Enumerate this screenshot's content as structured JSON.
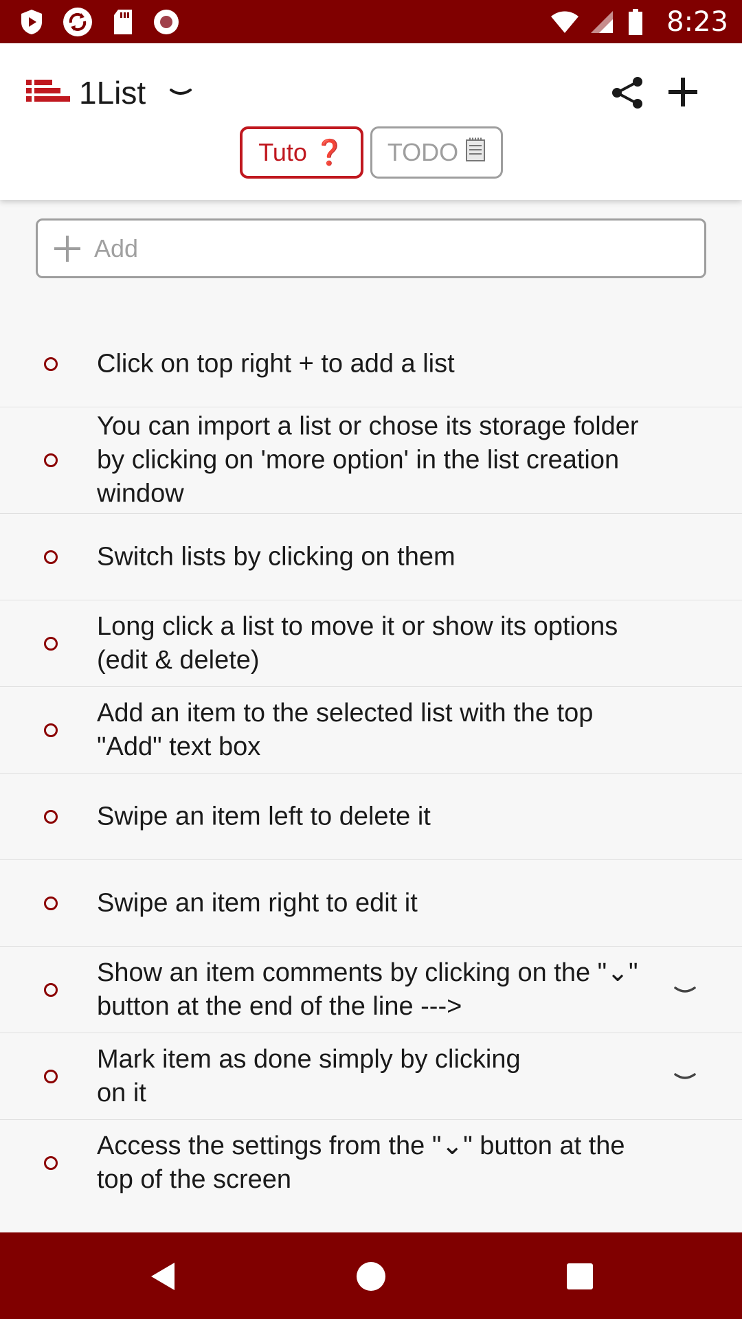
{
  "status_bar": {
    "time": "8:23",
    "icons": [
      "play-protect-icon",
      "sync-icon",
      "sd-card-icon",
      "record-icon",
      "wifi-icon",
      "signal-icon",
      "battery-icon"
    ]
  },
  "header": {
    "title": "1List",
    "tabs": [
      {
        "label": "Tuto",
        "emoji": "❓",
        "active": true
      },
      {
        "label": "TODO",
        "emoji": "🗒",
        "active": false
      }
    ]
  },
  "add_box": {
    "placeholder": "Add"
  },
  "items": [
    {
      "text": "Click on top right + to add a list",
      "has_comments": false
    },
    {
      "text": "You can import a list or chose its storage folder by clicking on 'more option' in the list creation window",
      "has_comments": false
    },
    {
      "text": "Switch lists by clicking on them",
      "has_comments": false
    },
    {
      "text": "Long click a list to move it or show its options (edit & delete)",
      "has_comments": false
    },
    {
      "text": "Add an item to the selected list with the top \"Add\" text box",
      "has_comments": false
    },
    {
      "text": "Swipe an item left to delete it",
      "has_comments": false
    },
    {
      "text": "Swipe an item right to edit it",
      "has_comments": false
    },
    {
      "text": "Show an item comments by clicking on the \"⌄\" button at the end of the line --->",
      "has_comments": true
    },
    {
      "text": "Mark item as done simply by clicking on it",
      "has_comments": true
    },
    {
      "text": "Access the settings from the \"⌄\" button at the top of the screen",
      "has_comments": false
    }
  ],
  "colors": {
    "primary": "#800000",
    "accent": "#c0181f",
    "bullet": "#8b0000",
    "inactive": "#9e9e9e"
  }
}
